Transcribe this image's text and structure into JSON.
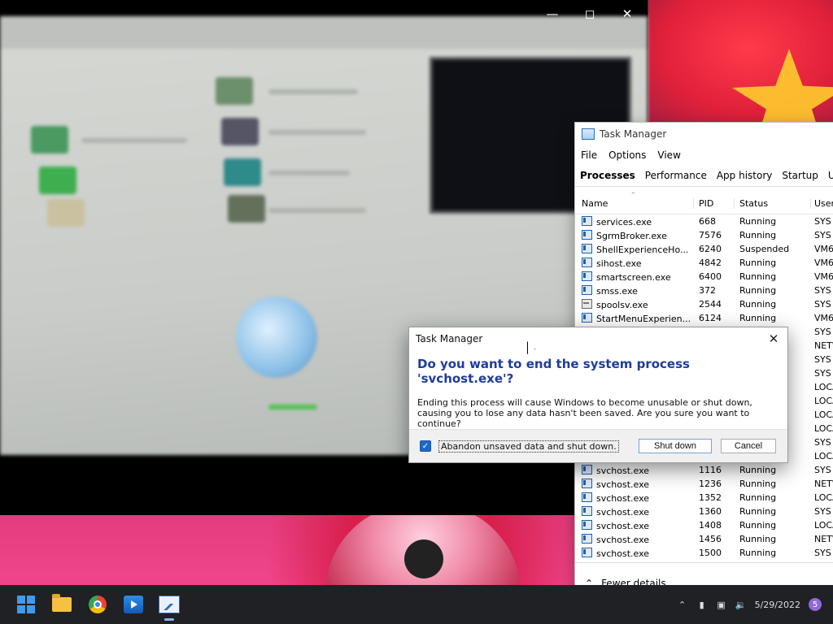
{
  "task_manager": {
    "title": "Task Manager",
    "menu": [
      "File",
      "Options",
      "View"
    ],
    "tabs": [
      "Processes",
      "Performance",
      "App history",
      "Startup",
      "User"
    ],
    "columns": {
      "name": "Name",
      "pid": "PID",
      "status": "Status",
      "user": "User"
    },
    "rows": [
      {
        "name": "services.exe",
        "pid": "668",
        "status": "Running",
        "user": "SYS",
        "icon": "process-icon"
      },
      {
        "name": "SgrmBroker.exe",
        "pid": "7576",
        "status": "Running",
        "user": "SYS",
        "icon": "process-icon"
      },
      {
        "name": "ShellExperienceHo...",
        "pid": "6240",
        "status": "Suspended",
        "user": "VM6",
        "icon": "process-icon"
      },
      {
        "name": "sihost.exe",
        "pid": "4842",
        "status": "Running",
        "user": "VM6",
        "icon": "process-icon"
      },
      {
        "name": "smartscreen.exe",
        "pid": "6400",
        "status": "Running",
        "user": "VM6",
        "icon": "process-icon"
      },
      {
        "name": "smss.exe",
        "pid": "372",
        "status": "Running",
        "user": "SYS",
        "icon": "process-icon"
      },
      {
        "name": "spoolsv.exe",
        "pid": "2544",
        "status": "Running",
        "user": "SYS",
        "icon": "printer-icon"
      },
      {
        "name": "StartMenuExperien...",
        "pid": "6124",
        "status": "Running",
        "user": "VM6",
        "icon": "process-icon"
      },
      {
        "name": "",
        "pid": "",
        "status": "",
        "user": "SYS",
        "icon": "process-icon"
      },
      {
        "name": "",
        "pid": "",
        "status": "",
        "user": "NETW",
        "icon": "process-icon"
      },
      {
        "name": "",
        "pid": "",
        "status": "",
        "user": "SYS",
        "icon": "process-icon"
      },
      {
        "name": "",
        "pid": "",
        "status": "",
        "user": "SYS",
        "icon": "process-icon"
      },
      {
        "name": "",
        "pid": "",
        "status": "",
        "user": "LOCA",
        "icon": "process-icon"
      },
      {
        "name": "",
        "pid": "",
        "status": "",
        "user": "LOCA",
        "icon": "process-icon"
      },
      {
        "name": "",
        "pid": "",
        "status": "",
        "user": "LOCA",
        "icon": "process-icon"
      },
      {
        "name": "",
        "pid": "",
        "status": "",
        "user": "LOCA",
        "icon": "process-icon"
      },
      {
        "name": "",
        "pid": "",
        "status": "",
        "user": "SYS",
        "icon": "process-icon"
      },
      {
        "name": "",
        "pid": "",
        "status": "",
        "user": "LOCA",
        "icon": "process-icon"
      },
      {
        "name": "svchost.exe",
        "pid": "1116",
        "status": "Running",
        "user": "SYS",
        "icon": "process-icon"
      },
      {
        "name": "svchost.exe",
        "pid": "1236",
        "status": "Running",
        "user": "NETW",
        "icon": "process-icon"
      },
      {
        "name": "svchost.exe",
        "pid": "1352",
        "status": "Running",
        "user": "LOCA",
        "icon": "process-icon"
      },
      {
        "name": "svchost.exe",
        "pid": "1360",
        "status": "Running",
        "user": "SYS",
        "icon": "process-icon"
      },
      {
        "name": "svchost.exe",
        "pid": "1408",
        "status": "Running",
        "user": "LOCA",
        "icon": "process-icon"
      },
      {
        "name": "svchost.exe",
        "pid": "1456",
        "status": "Running",
        "user": "NETW",
        "icon": "process-icon"
      },
      {
        "name": "svchost.exe",
        "pid": "1500",
        "status": "Running",
        "user": "SYS",
        "icon": "process-icon"
      }
    ],
    "footer_label": "Fewer details"
  },
  "dialog": {
    "title": "Task Manager",
    "heading": "Do you want to end the system process 'svchost.exe'?",
    "body": "Ending this process will cause Windows to become unusable or shut down, causing you to lose any data hasn't been saved. Are you sure you want to continue?",
    "checkbox_label": "Abandon unsaved data and shut down.",
    "checkbox_checked": true,
    "primary_button": "Shut down",
    "secondary_button": "Cancel"
  },
  "taskbar": {
    "apps": [
      "windows-start-icon",
      "file-explorer-icon",
      "chrome-icon",
      "video-player-icon",
      "task-manager-icon"
    ],
    "date": "5/29/2022",
    "notification_count": "5"
  },
  "colors": {
    "dialog_heading": "#1e3c9a",
    "checkbox_accent": "#1f66c9",
    "taskbar_bg": "#202124"
  }
}
